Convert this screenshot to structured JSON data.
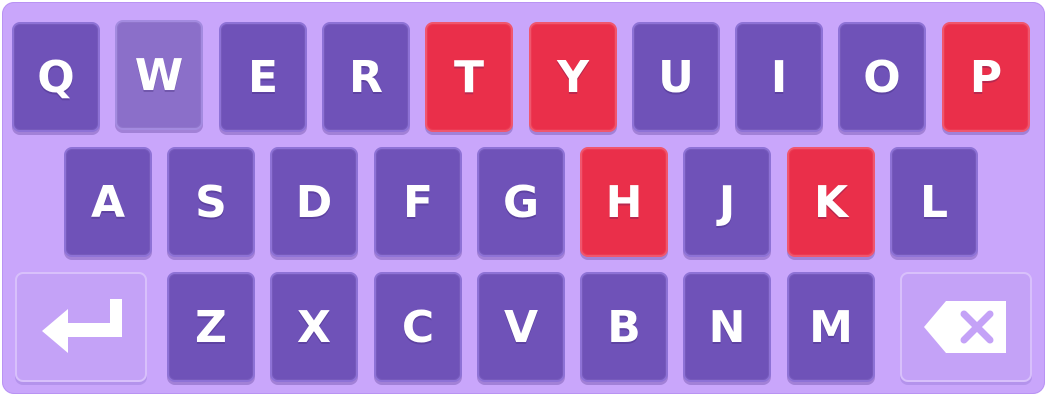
{
  "keyboard": {
    "row1": [
      "Q",
      "W",
      "E",
      "R",
      "T",
      "Y",
      "U",
      "I",
      "O",
      "P"
    ],
    "row2": [
      "A",
      "S",
      "D",
      "F",
      "G",
      "H",
      "J",
      "K",
      "L"
    ],
    "row3": [
      "Z",
      "X",
      "C",
      "V",
      "B",
      "N",
      "M"
    ],
    "enter_icon": "enter-arrow-icon",
    "backspace_icon": "backspace-icon",
    "highlighted_letters": [
      "T",
      "Y",
      "P",
      "H",
      "K"
    ],
    "pressed_letters": [
      "W"
    ],
    "colors": {
      "background": "#c9a6fb",
      "key": "#6f52b8",
      "highlighted": "#ea2f4a",
      "pressed": "#8b6fc9",
      "special_key": "#c4a2f7",
      "text": "#ffffff"
    }
  }
}
